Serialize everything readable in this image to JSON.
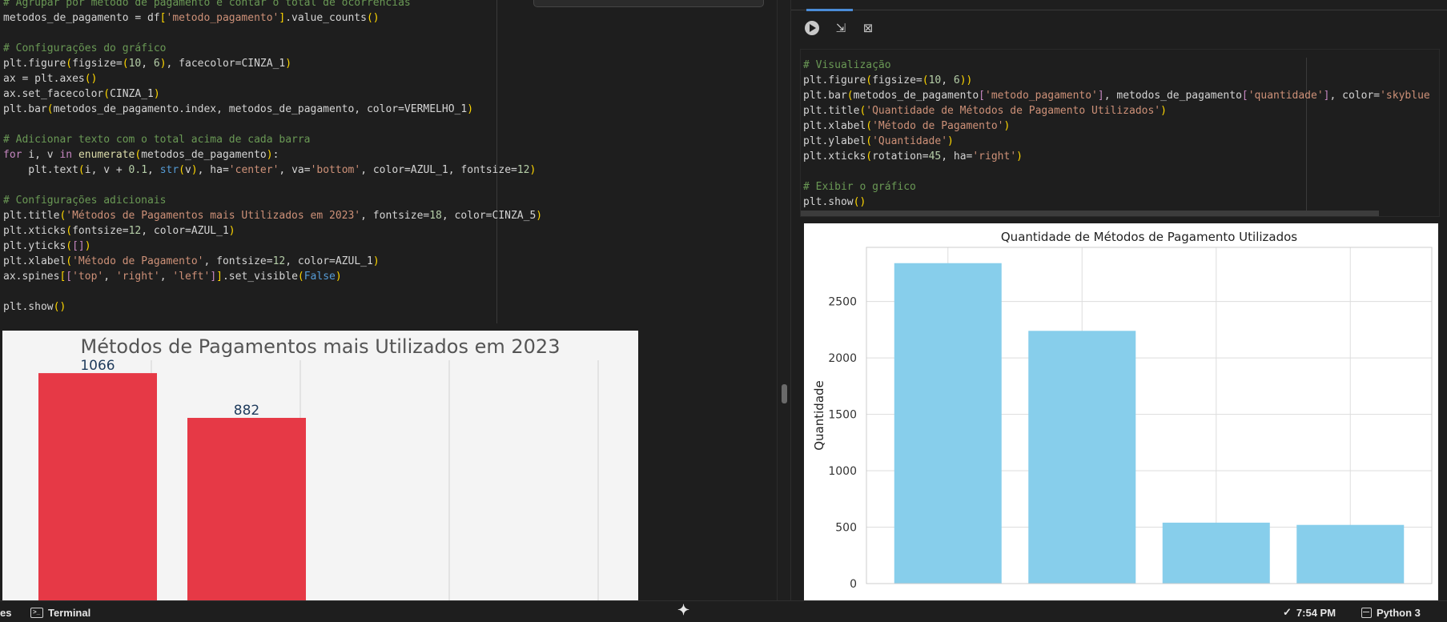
{
  "left_code": [
    [
      {
        "t": "# Agrupar por método de pagamento e contar o total de ocorrências",
        "c": "c"
      }
    ],
    [
      {
        "t": "metodos_de_pagamento = df"
      },
      {
        "t": "[",
        "c": "b"
      },
      {
        "t": "'metodo_pagamento'",
        "c": "s"
      },
      {
        "t": "]",
        "c": "b"
      },
      {
        "t": ".value_counts"
      },
      {
        "t": "()",
        "c": "b"
      }
    ],
    [],
    [
      {
        "t": "# Configurações do gráfico",
        "c": "c"
      }
    ],
    [
      {
        "t": "plt.figure"
      },
      {
        "t": "(",
        "c": "b"
      },
      {
        "t": "figsize="
      },
      {
        "t": "(",
        "c": "b"
      },
      {
        "t": "10",
        "c": "n"
      },
      {
        "t": ", "
      },
      {
        "t": "6",
        "c": "n"
      },
      {
        "t": ")",
        "c": "b"
      },
      {
        "t": ", facecolor=CINZA_1"
      },
      {
        "t": ")",
        "c": "b"
      }
    ],
    [
      {
        "t": "ax = plt.axes"
      },
      {
        "t": "()",
        "c": "b"
      }
    ],
    [
      {
        "t": "ax.set_facecolor"
      },
      {
        "t": "(",
        "c": "b"
      },
      {
        "t": "CINZA_1"
      },
      {
        "t": ")",
        "c": "b"
      }
    ],
    [
      {
        "t": "plt.bar"
      },
      {
        "t": "(",
        "c": "b"
      },
      {
        "t": "metodos_de_pagamento.index, metodos_de_pagamento, color=VERMELHO_1"
      },
      {
        "t": ")",
        "c": "b"
      }
    ],
    [],
    [
      {
        "t": "# Adicionar texto com o total acima de cada barra",
        "c": "c"
      }
    ],
    [
      {
        "t": "for",
        "c": "k"
      },
      {
        "t": " i, v "
      },
      {
        "t": "in",
        "c": "k"
      },
      {
        "t": " "
      },
      {
        "t": "enumerate",
        "c": "f"
      },
      {
        "t": "(",
        "c": "b"
      },
      {
        "t": "metodos_de_pagamento"
      },
      {
        "t": ")",
        "c": "b"
      },
      {
        "t": ":"
      }
    ],
    [
      {
        "t": "    plt.text"
      },
      {
        "t": "(",
        "c": "b"
      },
      {
        "t": "i, v + "
      },
      {
        "t": "0.1",
        "c": "n"
      },
      {
        "t": ", "
      },
      {
        "t": "str",
        "c": "kw"
      },
      {
        "t": "(",
        "c": "b"
      },
      {
        "t": "v"
      },
      {
        "t": ")",
        "c": "b"
      },
      {
        "t": ", ha="
      },
      {
        "t": "'center'",
        "c": "s"
      },
      {
        "t": ", va="
      },
      {
        "t": "'bottom'",
        "c": "s"
      },
      {
        "t": ", color=AZUL_1, fontsize="
      },
      {
        "t": "12",
        "c": "n"
      },
      {
        "t": ")",
        "c": "b"
      }
    ],
    [],
    [
      {
        "t": "# Configurações adicionais",
        "c": "c"
      }
    ],
    [
      {
        "t": "plt.title"
      },
      {
        "t": "(",
        "c": "b"
      },
      {
        "t": "'Métodos de Pagamentos mais Utilizados em 2023'",
        "c": "s"
      },
      {
        "t": ", fontsize="
      },
      {
        "t": "18",
        "c": "n"
      },
      {
        "t": ", color=CINZA_5"
      },
      {
        "t": ")",
        "c": "b"
      }
    ],
    [
      {
        "t": "plt.xticks"
      },
      {
        "t": "(",
        "c": "b"
      },
      {
        "t": "fontsize="
      },
      {
        "t": "12",
        "c": "n"
      },
      {
        "t": ", color=AZUL_1"
      },
      {
        "t": ")",
        "c": "b"
      }
    ],
    [
      {
        "t": "plt.yticks"
      },
      {
        "t": "(",
        "c": "b"
      },
      {
        "t": "[]",
        "c": "k"
      },
      {
        "t": ")",
        "c": "b"
      }
    ],
    [
      {
        "t": "plt.xlabel"
      },
      {
        "t": "(",
        "c": "b"
      },
      {
        "t": "'Método de Pagamento'",
        "c": "s"
      },
      {
        "t": ", fontsize="
      },
      {
        "t": "12",
        "c": "n"
      },
      {
        "t": ", color=AZUL_1"
      },
      {
        "t": ")",
        "c": "b"
      }
    ],
    [
      {
        "t": "ax.spines"
      },
      {
        "t": "[",
        "c": "b"
      },
      {
        "t": "[",
        "c": "k"
      },
      {
        "t": "'top'",
        "c": "s"
      },
      {
        "t": ", "
      },
      {
        "t": "'right'",
        "c": "s"
      },
      {
        "t": ", "
      },
      {
        "t": "'left'",
        "c": "s"
      },
      {
        "t": "]",
        "c": "k"
      },
      {
        "t": "]",
        "c": "b"
      },
      {
        "t": ".set_visible"
      },
      {
        "t": "(",
        "c": "b"
      },
      {
        "t": "False",
        "c": "kw"
      },
      {
        "t": ")",
        "c": "b"
      }
    ],
    [],
    [
      {
        "t": "plt.show"
      },
      {
        "t": "()",
        "c": "b"
      }
    ]
  ],
  "right_code": [
    [
      {
        "t": "# Visualização",
        "c": "c"
      }
    ],
    [
      {
        "t": "plt.figure"
      },
      {
        "t": "(",
        "c": "b"
      },
      {
        "t": "figsize="
      },
      {
        "t": "(",
        "c": "b"
      },
      {
        "t": "10",
        "c": "n"
      },
      {
        "t": ", "
      },
      {
        "t": "6",
        "c": "n"
      },
      {
        "t": ")",
        "c": "b"
      },
      {
        "t": ")",
        "c": "b"
      }
    ],
    [
      {
        "t": "plt.bar"
      },
      {
        "t": "(",
        "c": "b"
      },
      {
        "t": "metodos_de_pagamento"
      },
      {
        "t": "[",
        "c": "k"
      },
      {
        "t": "'metodo_pagamento'",
        "c": "s"
      },
      {
        "t": "]",
        "c": "k"
      },
      {
        "t": ", metodos_de_pagamento"
      },
      {
        "t": "[",
        "c": "k"
      },
      {
        "t": "'quantidade'",
        "c": "s"
      },
      {
        "t": "]",
        "c": "k"
      },
      {
        "t": ", color="
      },
      {
        "t": "'skyblue",
        "c": "s"
      }
    ],
    [
      {
        "t": "plt.title"
      },
      {
        "t": "(",
        "c": "b"
      },
      {
        "t": "'Quantidade de Métodos de Pagamento Utilizados'",
        "c": "s"
      },
      {
        "t": ")",
        "c": "b"
      }
    ],
    [
      {
        "t": "plt.xlabel"
      },
      {
        "t": "(",
        "c": "b"
      },
      {
        "t": "'Método de Pagamento'",
        "c": "s"
      },
      {
        "t": ")",
        "c": "b"
      }
    ],
    [
      {
        "t": "plt.ylabel"
      },
      {
        "t": "(",
        "c": "b"
      },
      {
        "t": "'Quantidade'",
        "c": "s"
      },
      {
        "t": ")",
        "c": "b"
      }
    ],
    [
      {
        "t": "plt.xticks"
      },
      {
        "t": "(",
        "c": "b"
      },
      {
        "t": "rotation="
      },
      {
        "t": "45",
        "c": "n"
      },
      {
        "t": ", ha="
      },
      {
        "t": "'right'",
        "c": "s"
      },
      {
        "t": ")",
        "c": "b"
      }
    ],
    [],
    [
      {
        "t": "# Exibir o gráfico",
        "c": "c"
      }
    ],
    [
      {
        "t": "plt.show"
      },
      {
        "t": "()",
        "c": "b"
      }
    ]
  ],
  "chart_data": [
    {
      "type": "bar",
      "title": "Métodos de Pagamentos mais Utilizados em 2023",
      "categories": [
        "",
        "",
        "",
        ""
      ],
      "values": [
        1066,
        882
      ],
      "data_labels": [
        "1066",
        "882"
      ],
      "ylim": [
        0,
        1119
      ],
      "grid": "vertical",
      "bar_color": "#e63946",
      "background": "#f4f4f4",
      "title_color": "#555555",
      "label_color": "#1f3b5c"
    },
    {
      "type": "bar",
      "title": "Quantidade de Métodos de Pagamento Utilizados",
      "ylabel": "Quantidade",
      "categories": [
        "",
        "",
        "",
        ""
      ],
      "values": [
        2840,
        2240,
        540,
        520
      ],
      "yticks": [
        0,
        500,
        1000,
        1500,
        2000,
        2500
      ],
      "ylim": [
        0,
        2980
      ],
      "grid": "both",
      "bar_color": "#87ceeb"
    }
  ],
  "status_bar": {
    "files_label": "es",
    "terminal_label": "Terminal",
    "time": "7:54 PM",
    "kernel": "Python 3"
  },
  "icons": [
    "play-icon",
    "collapse-icon",
    "clear-output-icon",
    "terminal-icon",
    "sparkle-icon",
    "check-icon",
    "kernel-icon"
  ]
}
